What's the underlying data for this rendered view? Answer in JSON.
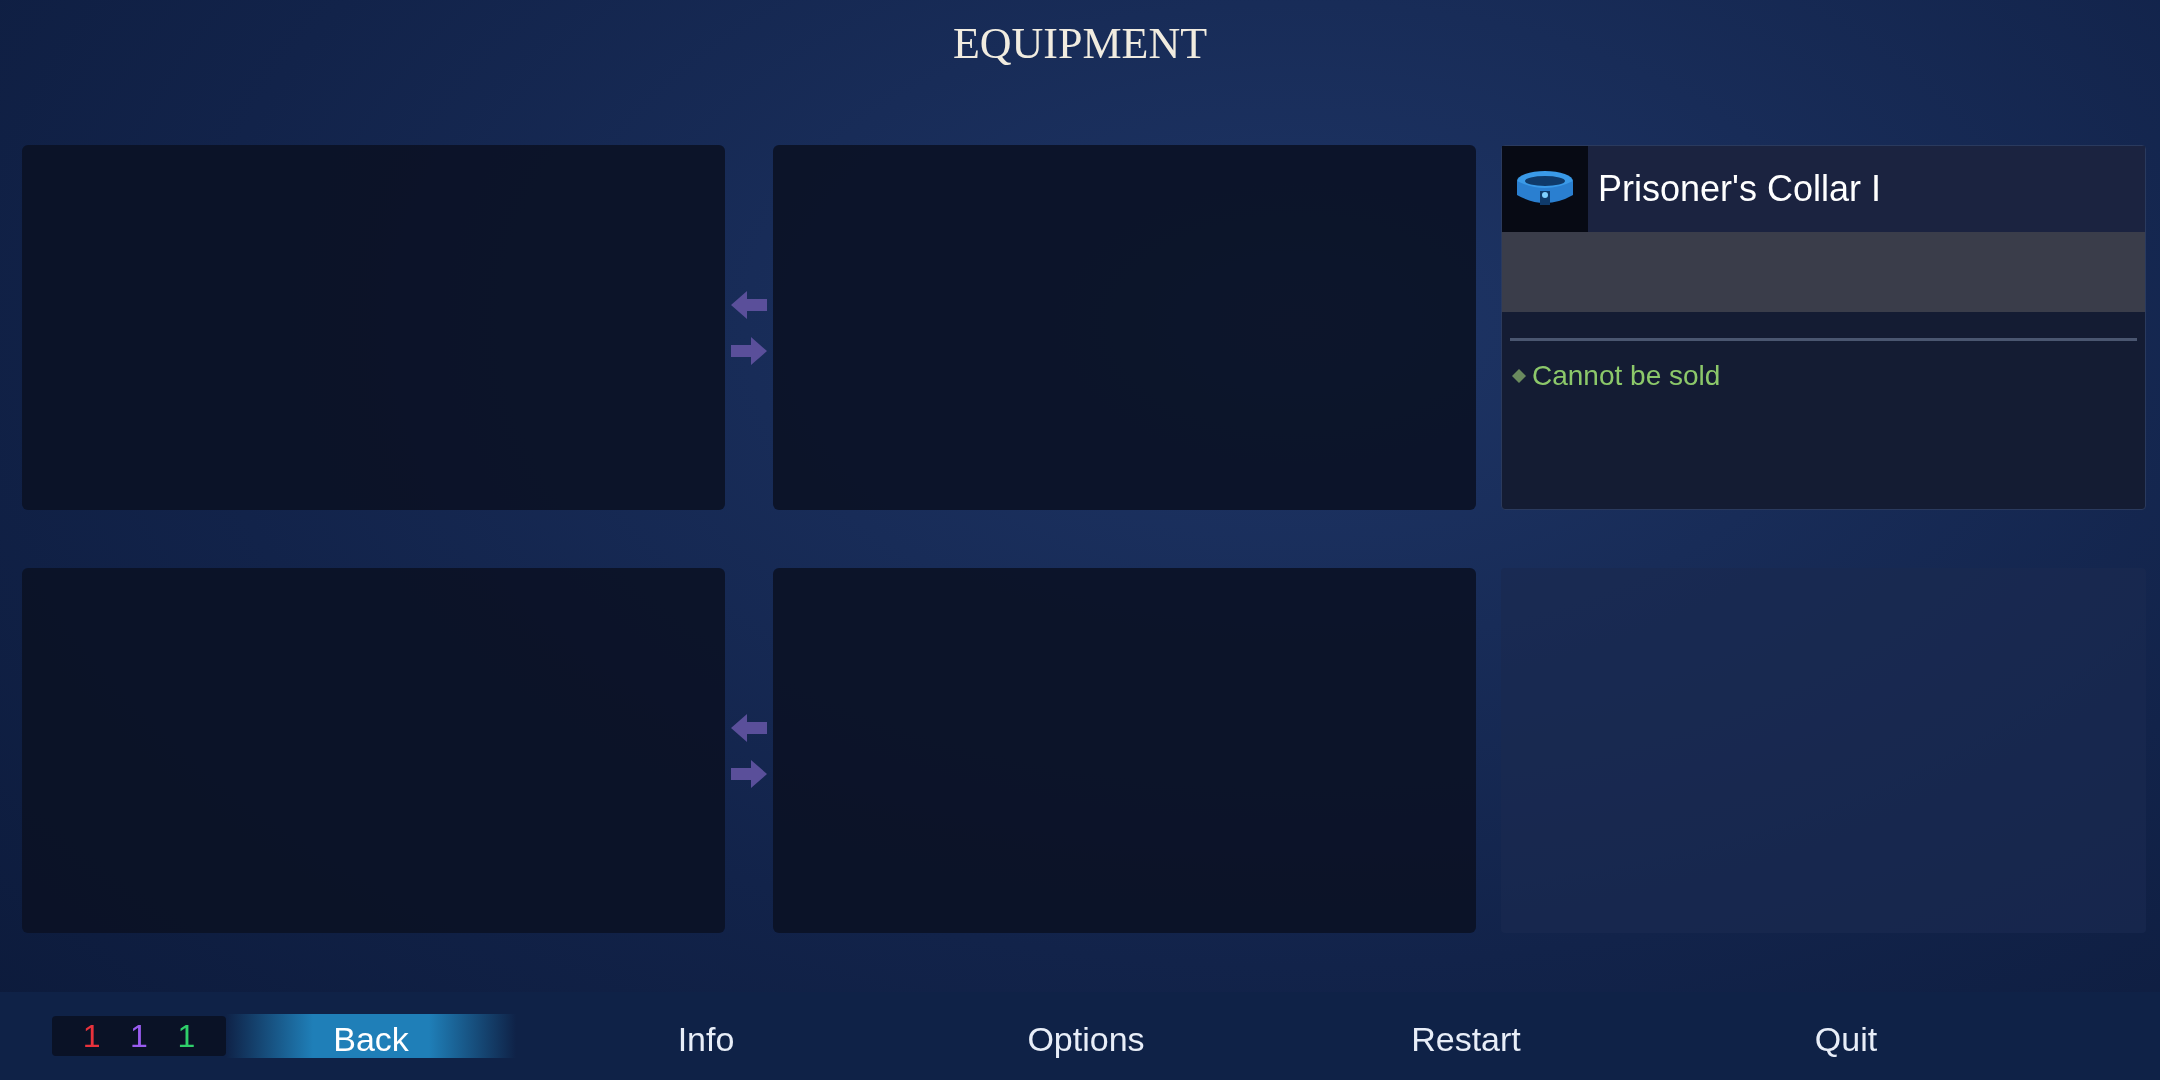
{
  "title": "EQUIPMENT",
  "item": {
    "name": "Prisoner's Collar I",
    "notes": [
      "Cannot be sold"
    ]
  },
  "counters": [
    {
      "text": "1",
      "color": "#e8323c"
    },
    {
      "text": "1",
      "color": "#9a5cf0"
    },
    {
      "text": "1",
      "color": "#2fcf6a"
    }
  ],
  "menu": [
    {
      "label": "Back",
      "selected": true
    },
    {
      "label": "Info",
      "selected": false
    },
    {
      "label": "Options",
      "selected": false
    },
    {
      "label": "Restart",
      "selected": false
    },
    {
      "label": "Quit",
      "selected": false
    }
  ]
}
